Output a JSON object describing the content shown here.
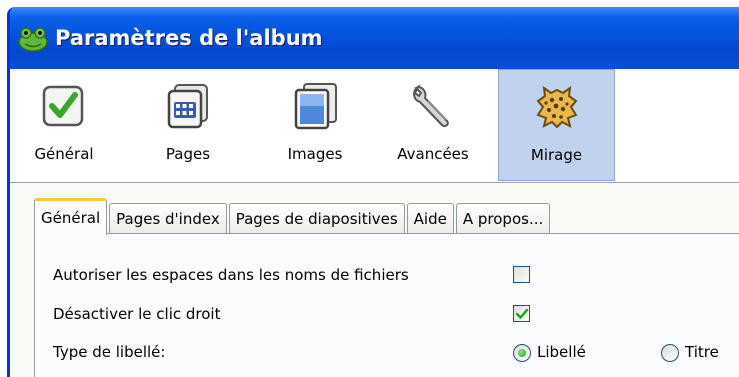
{
  "window": {
    "title": "Paramètres de l'album"
  },
  "toolbar": {
    "items": [
      {
        "label": "Général",
        "icon": "checkbox-icon"
      },
      {
        "label": "Pages",
        "icon": "pages-grid-icon"
      },
      {
        "label": "Images",
        "icon": "images-icon"
      },
      {
        "label": "Avancées",
        "icon": "wrench-icon"
      },
      {
        "label": "Mirage",
        "icon": "leopard-skin-icon",
        "selected": true
      }
    ]
  },
  "tabs": [
    {
      "label": "Général",
      "selected": true
    },
    {
      "label": "Pages d'index"
    },
    {
      "label": "Pages de diapositives"
    },
    {
      "label": "Aide"
    },
    {
      "label": "A propos..."
    }
  ],
  "options": {
    "allow_spaces": {
      "label": "Autoriser les espaces dans les noms de fichiers",
      "checked": false
    },
    "disable_right_click": {
      "label": "Désactiver le clic droit",
      "checked": true
    },
    "label_type": {
      "label": "Type de libellé:",
      "choices": [
        {
          "label": "Libellé",
          "selected": true
        },
        {
          "label": "Titre",
          "selected": false
        }
      ]
    }
  },
  "colors": {
    "titlebar": "#0653dd",
    "selected_tool": "#c1d2ee",
    "active_tab_accent": "#ffc83c",
    "check_green": "#21a121"
  }
}
